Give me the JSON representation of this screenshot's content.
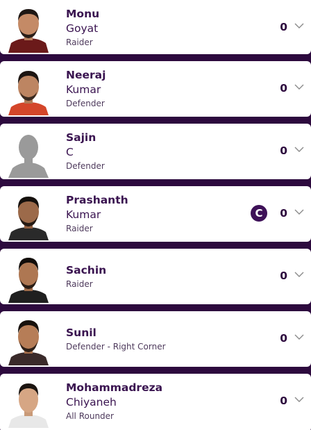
{
  "players": [
    {
      "first_name": "Monu",
      "last_name": "Goyat",
      "role": "Raider",
      "points": "0",
      "avatar": "player-photo",
      "captain": false
    },
    {
      "first_name": "Neeraj",
      "last_name": "Kumar",
      "role": "Defender",
      "points": "0",
      "avatar": "player-photo",
      "captain": false
    },
    {
      "first_name": "Sajin",
      "last_name": "C",
      "role": "Defender",
      "points": "0",
      "avatar": "placeholder-silhouette",
      "captain": false
    },
    {
      "first_name": "Prashanth",
      "last_name": "Kumar",
      "role": "Raider",
      "points": "0",
      "avatar": "player-photo",
      "captain": true,
      "captain_label": "C"
    },
    {
      "first_name": "Sachin",
      "role": "Raider",
      "points": "0",
      "avatar": "player-photo",
      "captain": false
    },
    {
      "first_name": "Sunil",
      "role": "Defender - Right Corner",
      "points": "0",
      "avatar": "player-photo",
      "captain": false
    },
    {
      "first_name": "Mohammadreza",
      "last_name": "Chiyaneh",
      "role": "All Rounder",
      "points": "0",
      "avatar": "player-photo",
      "captain": false
    }
  ],
  "colors": {
    "background": "#2d0a3e",
    "card": "#ffffff",
    "name_text": "#3a1450",
    "captain_badge": "#3e1158",
    "chevron": "#8a8a8a"
  },
  "icons": {
    "expand": "chevron-down-icon",
    "captain": "captain-badge-icon"
  }
}
